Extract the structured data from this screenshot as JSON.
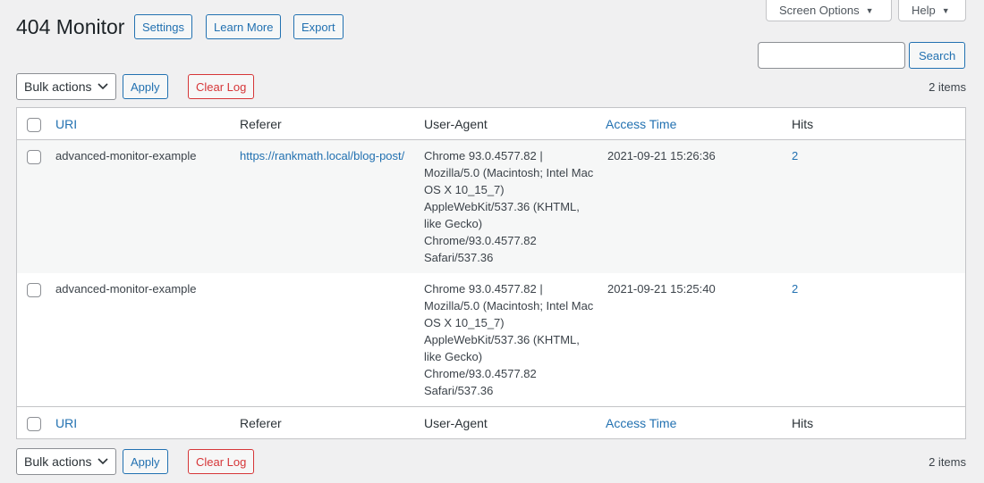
{
  "header": {
    "title": "404 Monitor",
    "buttons": {
      "settings": "Settings",
      "learn_more": "Learn More",
      "export": "Export"
    }
  },
  "screen_meta": {
    "screen_options": "Screen Options",
    "help": "Help"
  },
  "search": {
    "value": "",
    "button": "Search"
  },
  "tablenav": {
    "bulk_actions": "Bulk actions",
    "apply": "Apply",
    "clear_log": "Clear Log",
    "items_count": "2 items"
  },
  "table": {
    "columns": {
      "uri": "URI",
      "referer": "Referer",
      "user_agent": "User-Agent",
      "access_time": "Access Time",
      "hits": "Hits"
    },
    "rows": [
      {
        "uri": "advanced-monitor-example",
        "referer": "https://rankmath.local/blog-post/",
        "user_agent": "Chrome 93.0.4577.82 | Mozilla/5.0 (Macintosh; Intel Mac OS X 10_15_7) AppleWebKit/537.36 (KHTML, like Gecko) Chrome/93.0.4577.82 Safari/537.36",
        "access_time": "2021-09-21 15:26:36",
        "hits": "2"
      },
      {
        "uri": "advanced-monitor-example",
        "referer": "",
        "user_agent": "Chrome 93.0.4577.82 | Mozilla/5.0 (Macintosh; Intel Mac OS X 10_15_7) AppleWebKit/537.36 (KHTML, like Gecko) Chrome/93.0.4577.82 Safari/537.36",
        "access_time": "2021-09-21 15:25:40",
        "hits": "2"
      }
    ]
  },
  "colors": {
    "accent": "#2271b1",
    "danger": "#d63638",
    "background": "#f0f0f1"
  },
  "icons": {
    "caret": "triangle-down",
    "select_chevron": "chevron-down"
  }
}
